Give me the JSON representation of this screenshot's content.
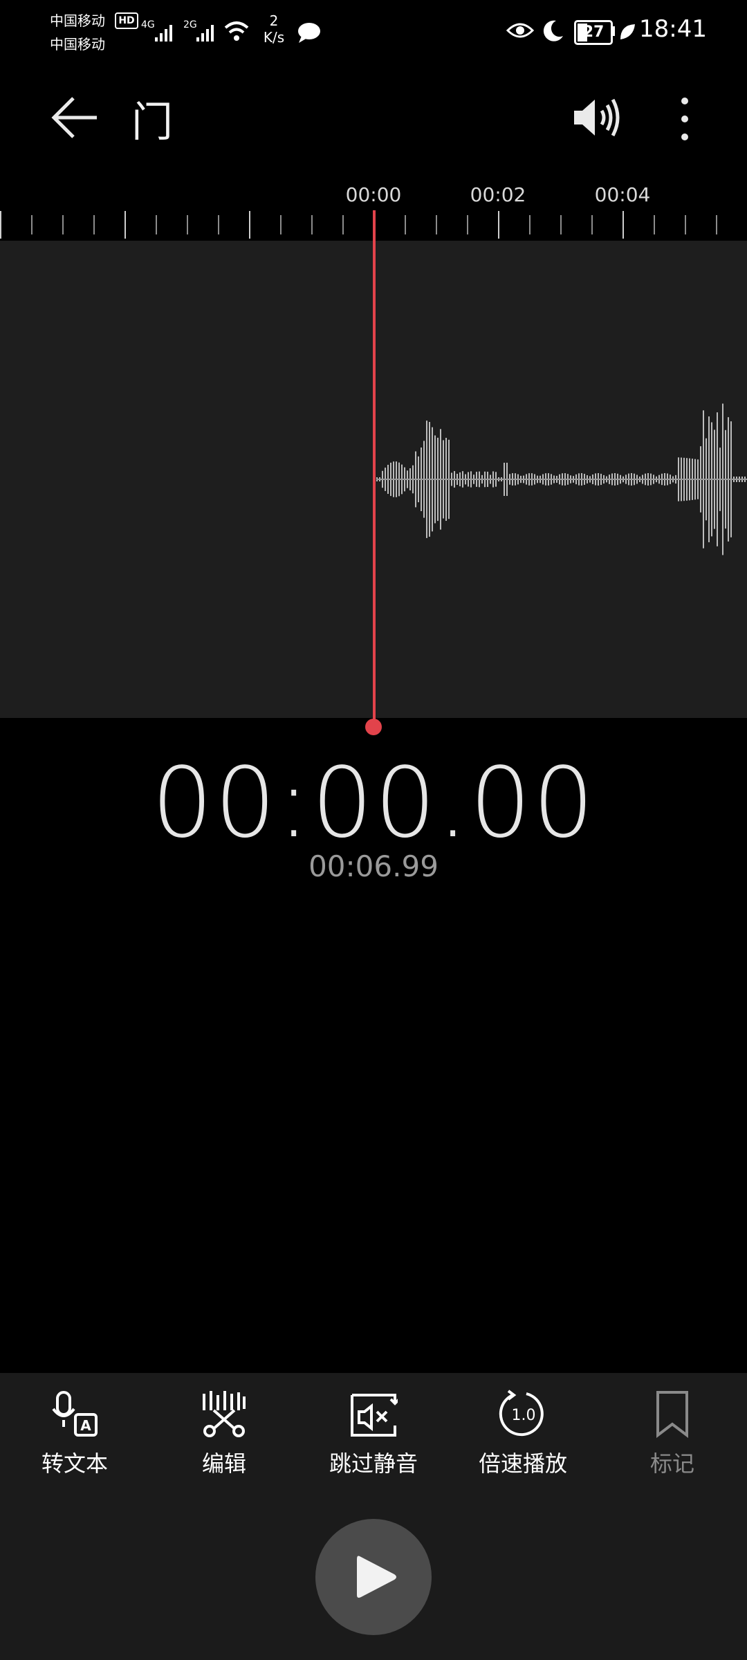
{
  "status_bar": {
    "carrier1": "中国移动",
    "hd_badge": "HD",
    "carrier2": "中国移动",
    "net1": "4G",
    "net2": "2G",
    "speed_value": "2",
    "speed_unit": "K/s",
    "battery": "27",
    "time": "18:41"
  },
  "header": {
    "title": "门"
  },
  "timeline": {
    "labels": [
      "00:00",
      "00:02",
      "00:04"
    ]
  },
  "player": {
    "current_time": "00:00.00",
    "total_time": "00:06.99",
    "progress_fraction": 0.0
  },
  "toolbar": {
    "items": [
      {
        "label": "转文本",
        "icon": "speech-to-text-icon"
      },
      {
        "label": "编辑",
        "icon": "edit-cut-icon"
      },
      {
        "label": "跳过静音",
        "icon": "skip-silence-icon"
      },
      {
        "label": "倍速播放",
        "icon": "playback-speed-icon",
        "speed_value": "1.0"
      },
      {
        "label": "标记",
        "icon": "bookmark-icon"
      }
    ]
  },
  "colors": {
    "accent": "#e2434b",
    "panel": "#1e1e1e"
  }
}
